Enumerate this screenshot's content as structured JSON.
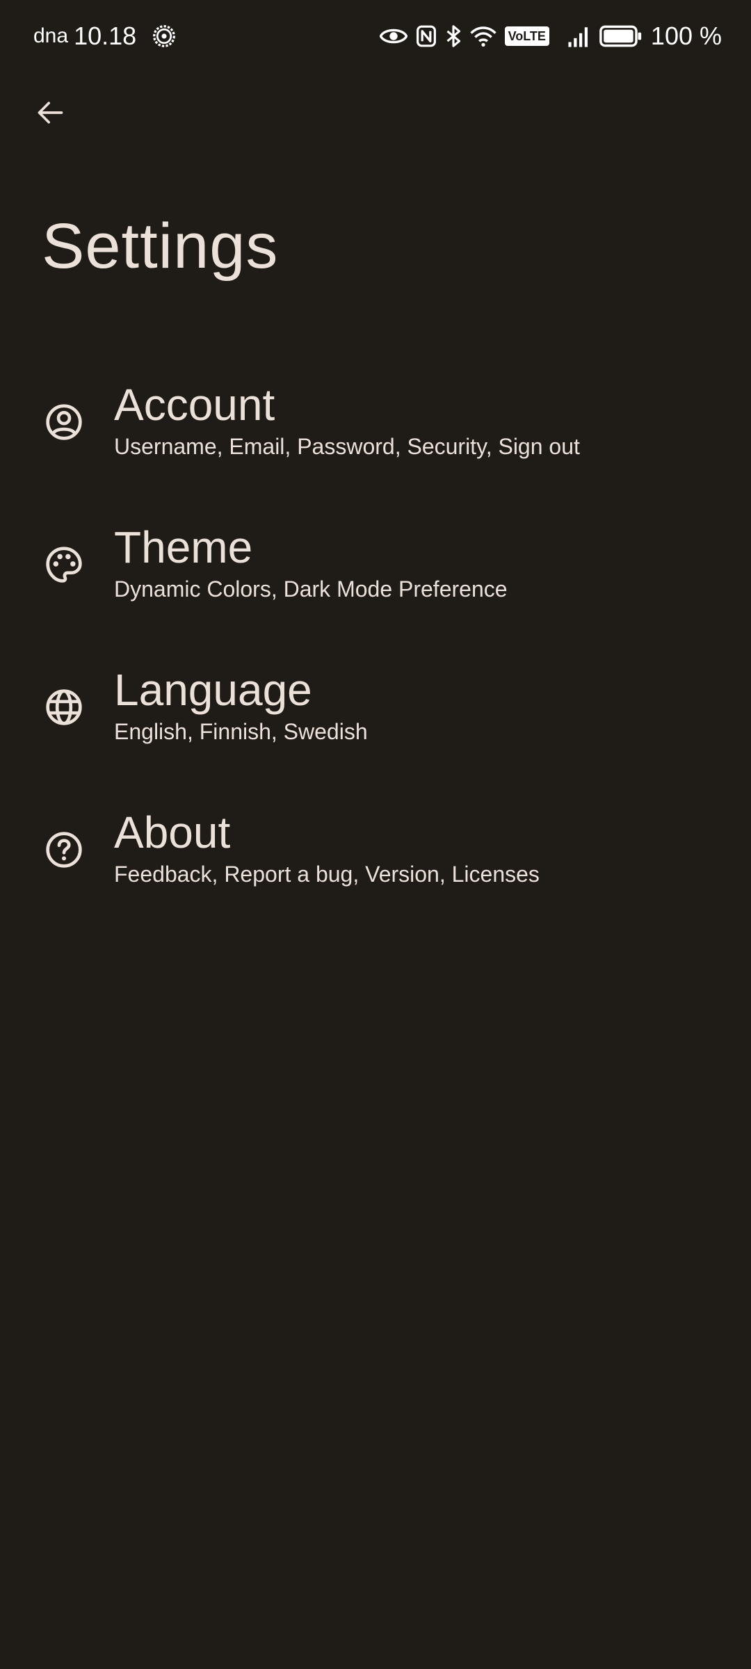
{
  "status_bar": {
    "carrier": "dna",
    "time": "10.18",
    "volte_label": "VoLTE",
    "battery_percent": "100 %",
    "icons": [
      "settings-gear-icon",
      "eye-icon",
      "nfc-icon",
      "bluetooth-icon",
      "wifi-icon",
      "volte-icon",
      "signal-icon",
      "battery-icon"
    ]
  },
  "header": {
    "back_icon": "arrow-left-icon",
    "title": "Settings"
  },
  "settings": {
    "items": [
      {
        "label": "Account",
        "subtitle": "Username, Email, Password, Security, Sign out",
        "icon": "account-circle-icon"
      },
      {
        "label": "Theme",
        "subtitle": "Dynamic Colors, Dark Mode Preference",
        "icon": "palette-icon"
      },
      {
        "label": "Language",
        "subtitle": "English, Finnish, Swedish",
        "icon": "globe-icon"
      },
      {
        "label": "About",
        "subtitle": "Feedback, Report a bug, Version, Licenses",
        "icon": "help-circle-icon"
      }
    ]
  },
  "colors": {
    "background": "#1f1b17",
    "text": "#ebe1d9",
    "status_text": "#ffffff"
  }
}
